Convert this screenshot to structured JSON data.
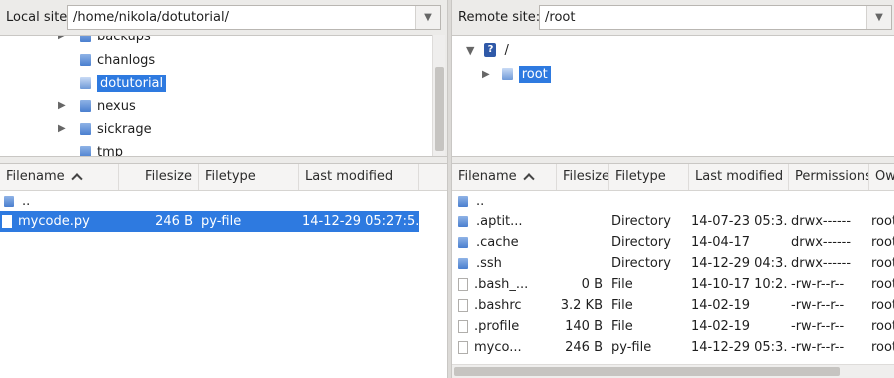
{
  "local": {
    "label": "Local site:",
    "path": "/home/nikola/dotutorial/",
    "tree": [
      {
        "label": "backups",
        "expander": true
      },
      {
        "label": "chanlogs",
        "expander": false
      },
      {
        "label": "dotutorial",
        "expander": false,
        "selected": true
      },
      {
        "label": "nexus",
        "expander": true
      },
      {
        "label": "sickrage",
        "expander": true
      },
      {
        "label": "tmp",
        "expander": false
      }
    ],
    "columns": [
      "Filename",
      "Filesize",
      "Filetype",
      "Last modified"
    ],
    "files": [
      {
        "name": "..",
        "size": "",
        "type": "",
        "modified": "",
        "kind": "folder"
      },
      {
        "name": "mycode.py",
        "size": "246 B",
        "type": "py-file",
        "modified": "14-12-29 05:27:5...",
        "kind": "file",
        "selected": true
      }
    ]
  },
  "remote": {
    "label": "Remote site:",
    "path": "/root",
    "tree": [
      {
        "label": "/",
        "icon": "unknown"
      },
      {
        "label": "root",
        "selected": true
      }
    ],
    "columns": [
      "Filename",
      "Filesize",
      "Filetype",
      "Last modified",
      "Permissions",
      "Ow"
    ],
    "files": [
      {
        "name": "..",
        "size": "",
        "type": "",
        "modified": "",
        "perms": "",
        "owner": "",
        "kind": "folder"
      },
      {
        "name": ".aptit...",
        "size": "",
        "type": "Directory",
        "modified": "14-07-23 05:3...",
        "perms": "drwx------",
        "owner": "root",
        "kind": "folder"
      },
      {
        "name": ".cache",
        "size": "",
        "type": "Directory",
        "modified": "14-04-17",
        "perms": "drwx------",
        "owner": "root",
        "kind": "folder"
      },
      {
        "name": ".ssh",
        "size": "",
        "type": "Directory",
        "modified": "14-12-29 04:3...",
        "perms": "drwx------",
        "owner": "root",
        "kind": "folder"
      },
      {
        "name": ".bash_...",
        "size": "0 B",
        "type": "File",
        "modified": "14-10-17 10:2...",
        "perms": "-rw-r--r--",
        "owner": "root",
        "kind": "file"
      },
      {
        "name": ".bashrc",
        "size": "3.2 KB",
        "type": "File",
        "modified": "14-02-19",
        "perms": "-rw-r--r--",
        "owner": "root",
        "kind": "file"
      },
      {
        "name": ".profile",
        "size": "140 B",
        "type": "File",
        "modified": "14-02-19",
        "perms": "-rw-r--r--",
        "owner": "root",
        "kind": "file"
      },
      {
        "name": "myco...",
        "size": "246 B",
        "type": "py-file",
        "modified": "14-12-29 05:3...",
        "perms": "-rw-r--r--",
        "owner": "root",
        "kind": "file"
      }
    ]
  },
  "icons": {
    "dropdown": "chevron-down-icon",
    "folder": "folder-icon",
    "file": "file-icon",
    "expand": "triangle-right-icon",
    "collapse": "triangle-down-icon",
    "unknown": "question-icon",
    "sort": "sort-ascending-icon"
  },
  "colors": {
    "selection": "#2e7ae0",
    "folder": "#4a7fcf"
  }
}
